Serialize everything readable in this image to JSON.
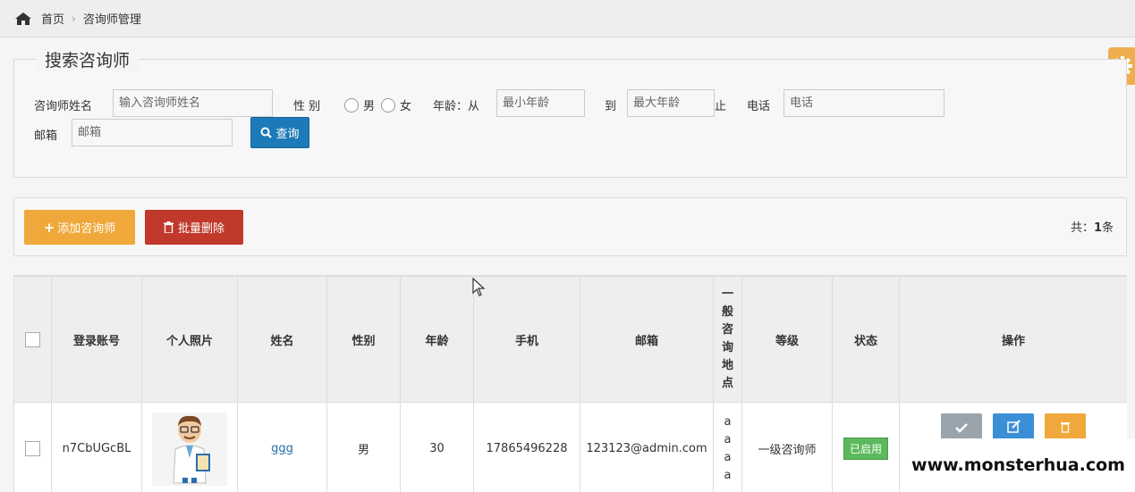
{
  "breadcrumb": {
    "home": "首页",
    "current": "咨询师管理"
  },
  "search": {
    "legend": "搜索咨询师",
    "name_label": "咨询师姓名",
    "name_placeholder": "输入咨询师姓名",
    "gender_label": "性 别",
    "gender_male": "男",
    "gender_female": "女",
    "age_label": "年龄：从",
    "age_min_placeholder": "最小年龄",
    "age_to": "到",
    "age_max_placeholder": "最大年龄",
    "age_end": "止",
    "phone_label": "电话",
    "phone_placeholder": "电话",
    "email_label": "邮箱",
    "email_placeholder": "邮箱",
    "query_button": "查询"
  },
  "toolbar": {
    "add_button": "添加咨询师",
    "batch_delete_button": "批量删除",
    "count_prefix": "共：",
    "count_value": "1",
    "count_suffix": "条"
  },
  "table": {
    "headers": [
      "登录账号",
      "个人照片",
      "姓名",
      "性别",
      "年龄",
      "手机",
      "邮箱",
      "一般咨询地点",
      "等级",
      "状态",
      "操作"
    ],
    "rows": [
      {
        "account": "n7CbUGcBL",
        "name": "ggg",
        "gender": "男",
        "age": "30",
        "phone": "17865496228",
        "email": "123123@admin.com",
        "location": "aaaa",
        "level": "一级咨询师",
        "status": "已启用"
      }
    ]
  },
  "watermark": "www.monsterhua.com",
  "colors": {
    "primary": "#1c7ab8",
    "warning": "#f0a83a",
    "danger": "#c0392b",
    "success": "#5cb85c"
  }
}
